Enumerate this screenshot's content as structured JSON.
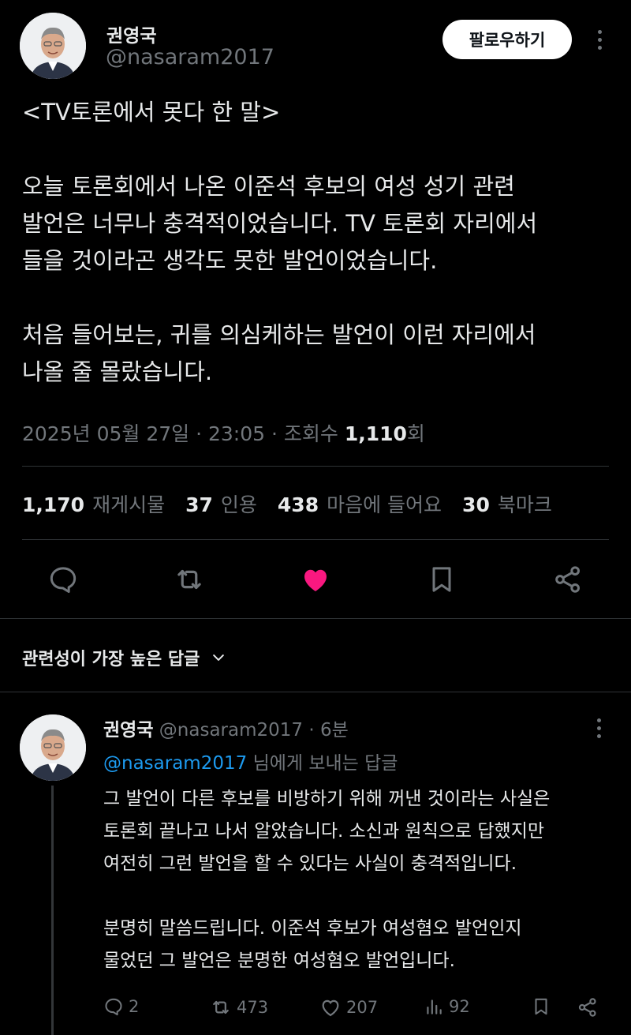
{
  "tweet": {
    "author_name": "권영국",
    "handle": "@nasaram2017",
    "follow_label": "팔로우하기",
    "text": "<TV토론에서 못다 한 말>\n\n오늘 토론회에서 나온 이준석 후보의 여성 성기 관련\n발언은 너무나 충격적이었습니다. TV 토론회 자리에서\n들을 것이라곤 생각도 못한 발언이었습니다.\n\n처음 들어보는, 귀를 의심케하는 발언이 이런 자리에서\n나올 줄 몰랐습니다.",
    "date": "2025년 05월 27일",
    "time": "23:05",
    "views_label": "조회수",
    "views": "1,110",
    "views_suffix": "회",
    "stats": {
      "retweets": "1,170",
      "retweets_label": "재게시물",
      "quotes": "37",
      "quotes_label": "인용",
      "likes": "438",
      "likes_label": "마음에 들어요",
      "bookmarks": "30",
      "bookmarks_label": "북마크"
    }
  },
  "icons": {
    "reply": "reply-icon",
    "retweet": "retweet-icon",
    "like": "heart-icon",
    "bookmark": "bookmark-icon",
    "share": "share-icon",
    "views": "bar-chart-icon"
  },
  "colors": {
    "like": "#f91880",
    "link": "#1d9bf0",
    "muted": "#71767b"
  },
  "replies_sort_label": "관련성이 가장 높은 답글",
  "reply": {
    "author_name": "권영국",
    "handle": "@nasaram2017",
    "time_ago": "6분",
    "reply_to_handle": "@nasaram2017",
    "reply_to_suffix": "님에게 보내는 답글",
    "text": "그 발언이 다른 후보를 비방하기 위해 꺼낸 것이라는 사실은\n토론회 끝나고 나서 알았습니다. 소신과 원칙으로 답했지만\n여전히 그런 발언을 할 수 있다는 사실이 충격적입니다.\n\n분명히 말씀드립니다. 이준석 후보가 여성혐오 발언인지\n물었던 그 발언은 분명한 여성혐오 발언입니다.",
    "replies": "2",
    "retweets": "473",
    "likes": "207",
    "views": "92"
  }
}
